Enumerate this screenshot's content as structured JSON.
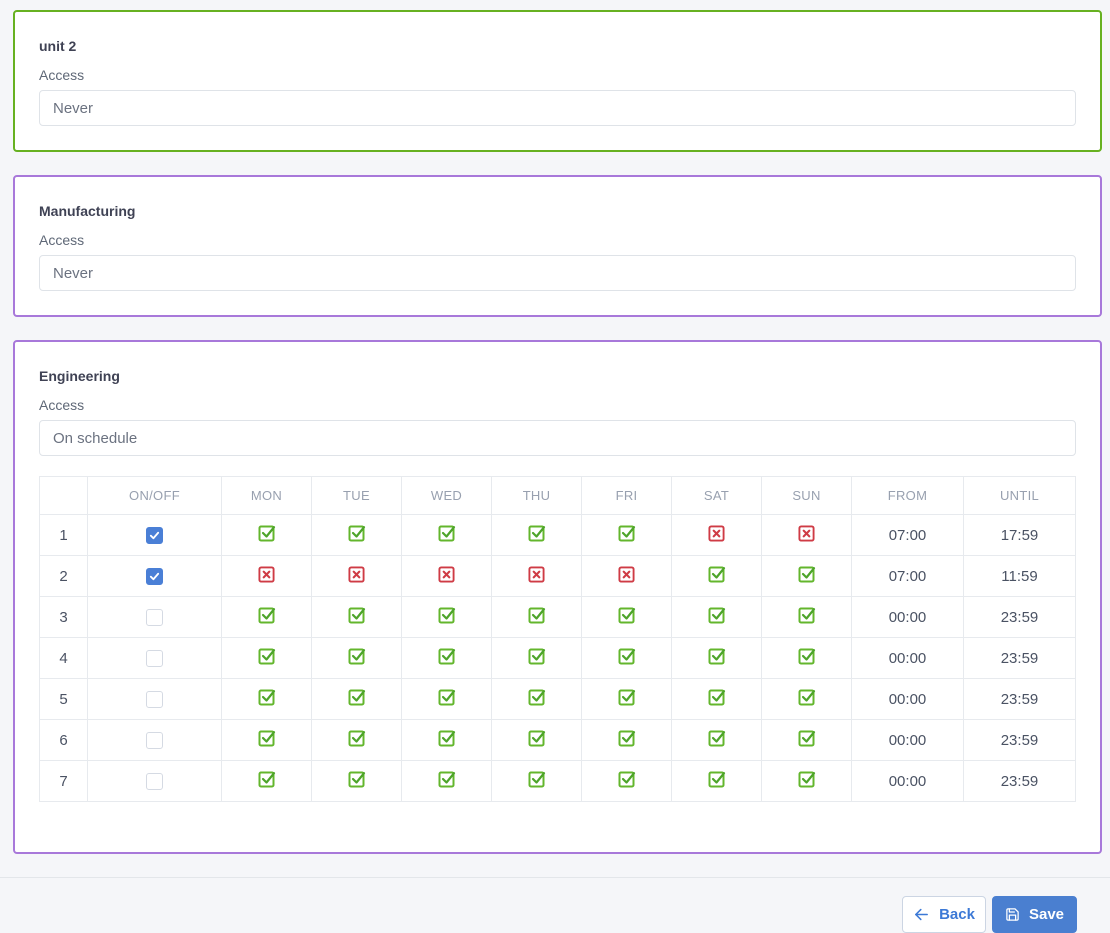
{
  "cards": [
    {
      "id": "unit2",
      "title": "unit 2",
      "access_label": "Access",
      "access_value": "Never"
    },
    {
      "id": "manufacturing",
      "title": "Manufacturing",
      "access_label": "Access",
      "access_value": "Never"
    },
    {
      "id": "engineering",
      "title": "Engineering",
      "access_label": "Access",
      "access_value": "On schedule"
    }
  ],
  "schedule": {
    "headers": [
      "",
      "ON/OFF",
      "MON",
      "TUE",
      "WED",
      "THU",
      "FRI",
      "SAT",
      "SUN",
      "FROM",
      "UNTIL"
    ],
    "rows": [
      {
        "num": "1",
        "enabled": true,
        "days": [
          true,
          true,
          true,
          true,
          true,
          false,
          false
        ],
        "from": "07:00",
        "until": "17:59"
      },
      {
        "num": "2",
        "enabled": true,
        "days": [
          false,
          false,
          false,
          false,
          false,
          true,
          true
        ],
        "from": "07:00",
        "until": "11:59"
      },
      {
        "num": "3",
        "enabled": false,
        "days": [
          true,
          true,
          true,
          true,
          true,
          true,
          true
        ],
        "from": "00:00",
        "until": "23:59"
      },
      {
        "num": "4",
        "enabled": false,
        "days": [
          true,
          true,
          true,
          true,
          true,
          true,
          true
        ],
        "from": "00:00",
        "until": "23:59"
      },
      {
        "num": "5",
        "enabled": false,
        "days": [
          true,
          true,
          true,
          true,
          true,
          true,
          true
        ],
        "from": "00:00",
        "until": "23:59"
      },
      {
        "num": "6",
        "enabled": false,
        "days": [
          true,
          true,
          true,
          true,
          true,
          true,
          true
        ],
        "from": "00:00",
        "until": "23:59"
      },
      {
        "num": "7",
        "enabled": false,
        "days": [
          true,
          true,
          true,
          true,
          true,
          true,
          true
        ],
        "from": "00:00",
        "until": "23:59"
      }
    ]
  },
  "footer": {
    "back_label": "Back",
    "save_label": "Save"
  },
  "colors": {
    "card_border_green": "#67b121",
    "card_border_purple": "#a878da",
    "allowed_icon": "#63b62c",
    "allowed_icon_check": "#4da42a",
    "denied_icon": "#cf3b45",
    "checkbox_checked": "#4a7fd6",
    "save_button": "#4a7fd0",
    "back_text": "#3c79d6",
    "page_background": "#f5f6f9"
  }
}
